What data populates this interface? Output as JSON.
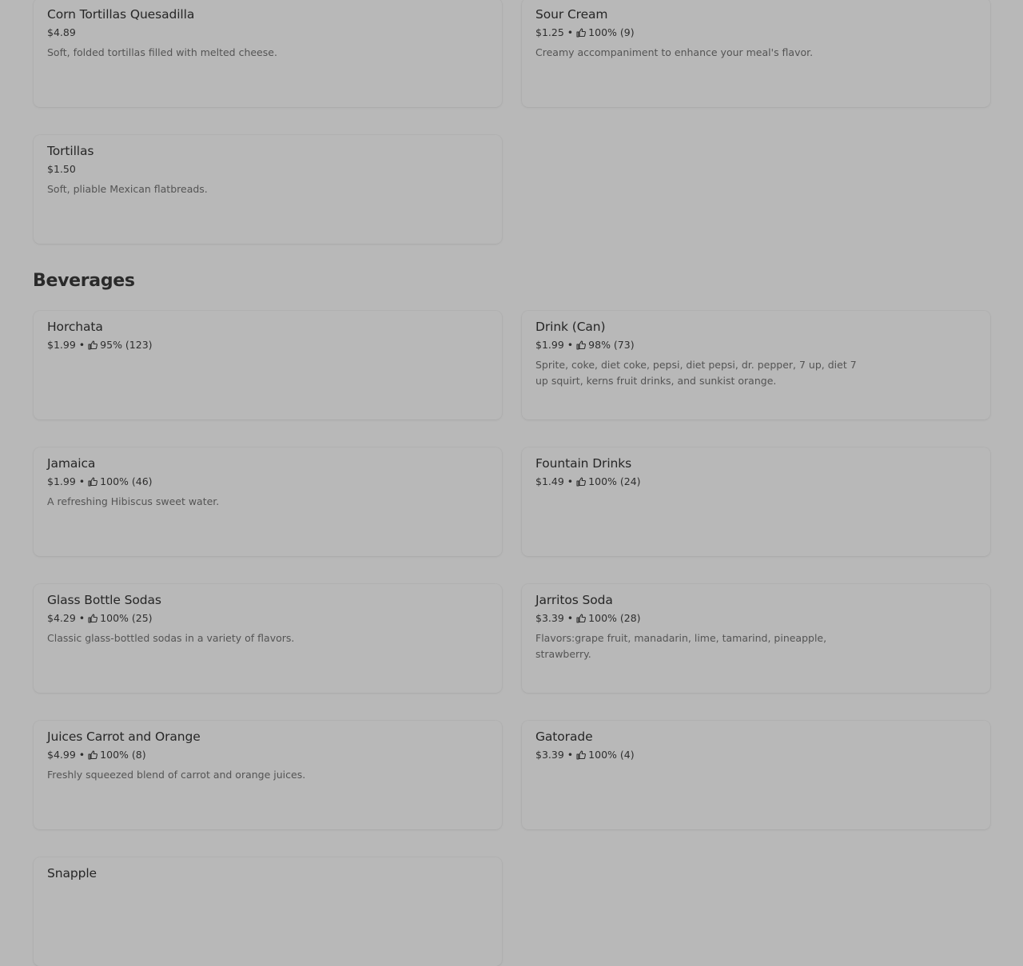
{
  "sections": {
    "beverages_title": "Beverages"
  },
  "items": {
    "corn_tortillas_quesadilla": {
      "name": "Corn Tortillas Quesadilla",
      "price": "$4.89",
      "description": "Soft, folded tortillas filled with melted cheese."
    },
    "sour_cream": {
      "name": "Sour Cream",
      "price": "$1.25",
      "rating": "100% (9)",
      "description": "Creamy accompaniment to enhance your meal's flavor."
    },
    "tortillas": {
      "name": "Tortillas",
      "price": "$1.50",
      "description": "Soft, pliable Mexican flatbreads."
    },
    "horchata": {
      "name": "Horchata",
      "price": "$1.99",
      "rating": "95% (123)"
    },
    "drink_can": {
      "name": "Drink (Can)",
      "price": "$1.99",
      "rating": "98% (73)",
      "description": "Sprite, coke, diet coke, pepsi, diet pepsi, dr. pepper, 7 up, diet 7 up squirt, kerns fruit drinks, and sunkist orange."
    },
    "jamaica": {
      "name": "Jamaica",
      "price": "$1.99",
      "rating": "100% (46)",
      "description": "A refreshing Hibiscus sweet water."
    },
    "fountain_drinks": {
      "name": "Fountain Drinks",
      "price": "$1.49",
      "rating": "100% (24)"
    },
    "glass_bottle_sodas": {
      "name": "Glass Bottle Sodas",
      "price": "$4.29",
      "rating": "100% (25)",
      "description": "Classic glass-bottled sodas in a variety of flavors."
    },
    "jarritos_soda": {
      "name": "Jarritos Soda",
      "price": "$3.39",
      "rating": "100% (28)",
      "description": "Flavors:grape fruit, manadarin, lime, tamarind, pineapple, strawberry."
    },
    "juices_carrot_orange": {
      "name": "Juices Carrot and Orange",
      "price": "$4.99",
      "rating": "100% (8)",
      "description": "Freshly squeezed blend of carrot and orange juices."
    },
    "gatorade": {
      "name": "Gatorade",
      "price": "$3.39",
      "rating": "100% (4)"
    },
    "snapple": {
      "name": "Snapple"
    }
  },
  "meta": {
    "separator": "•"
  },
  "icons": {
    "rating": "thumbs-up-icon"
  },
  "colors": {
    "background": "#b8b8b8",
    "text_primary": "#262626",
    "text_secondary": "#545454"
  }
}
